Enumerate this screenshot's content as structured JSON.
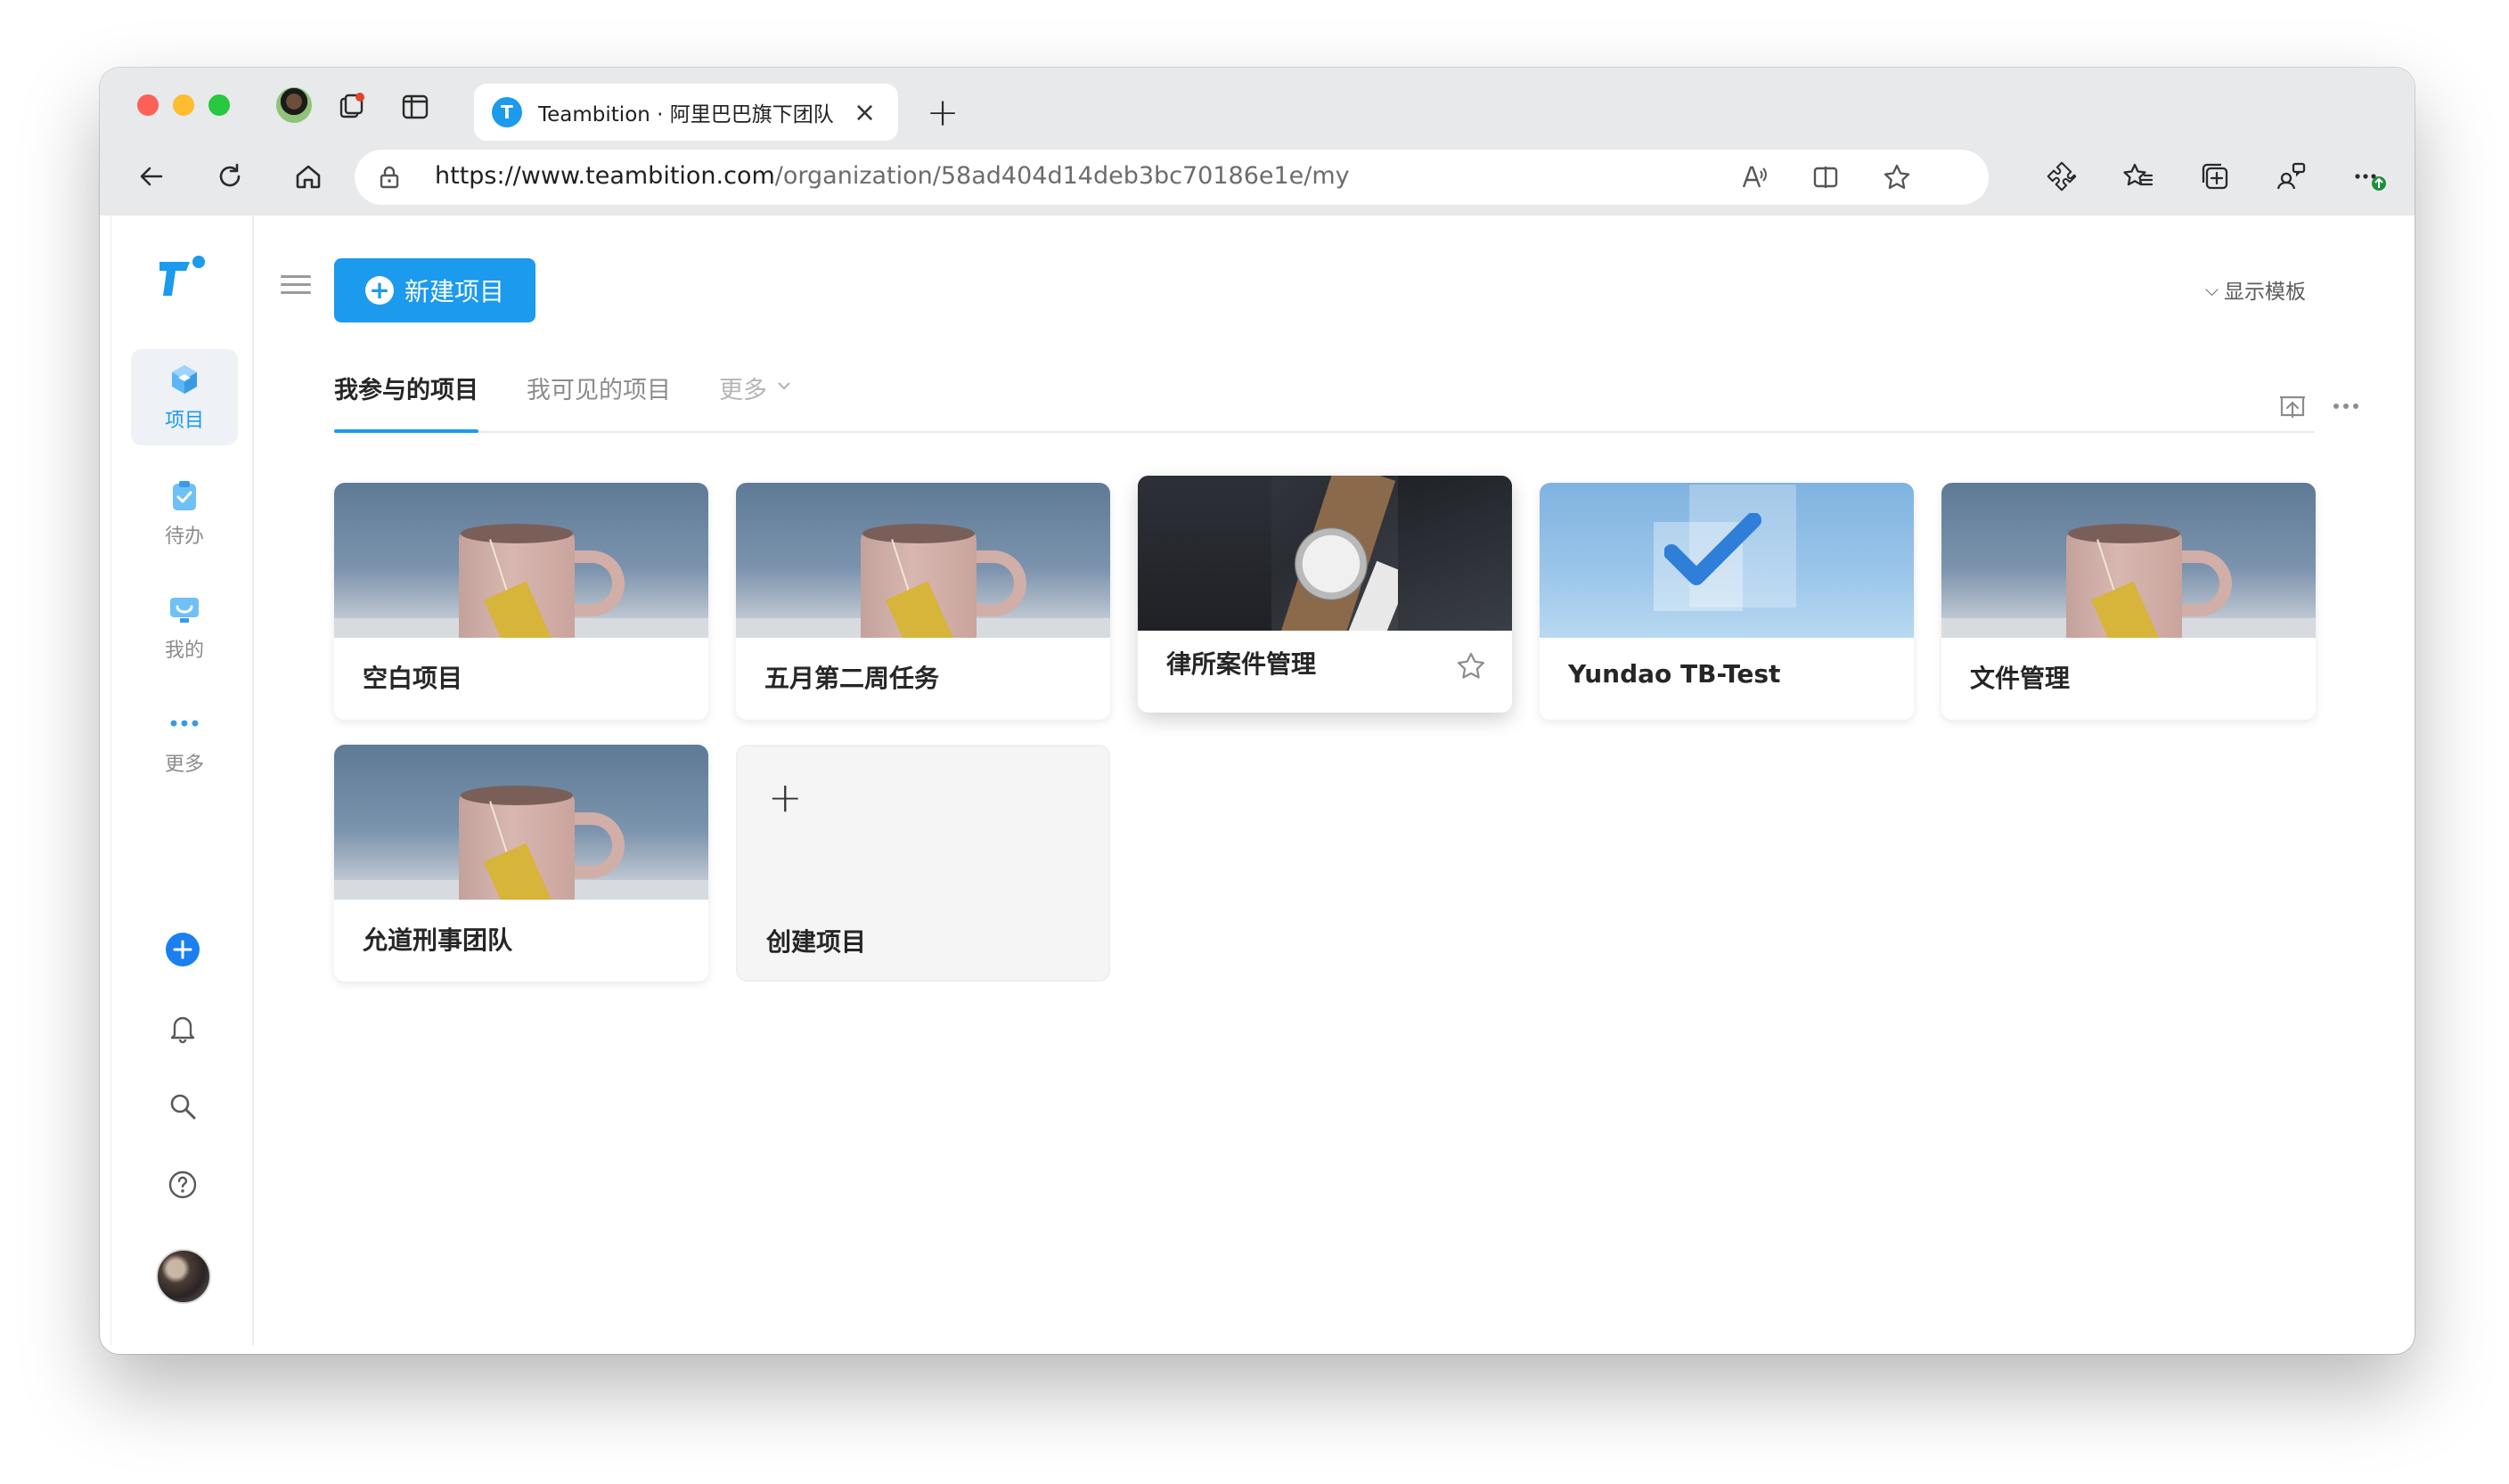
{
  "browser": {
    "tab_title": "Teambition · 阿里巴巴旗下团队",
    "tab_favicon_letter": "T",
    "url_host": "https://www.teambition.com",
    "url_path": "/organization/58ad404d14deb3bc70186e1e/my",
    "icons": [
      "back-icon",
      "refresh-icon",
      "home-icon",
      "lock-icon",
      "read-aloud-icon",
      "split-screen-icon",
      "favorite-star-icon",
      "extensions-icon",
      "favorites-icon",
      "collections-icon",
      "profile-sync-icon",
      "more-icon"
    ]
  },
  "sidebar": {
    "items": [
      {
        "label": "项目",
        "icon": "project-cube-icon",
        "active": true
      },
      {
        "label": "待办",
        "icon": "todo-clipboard-icon",
        "active": false
      },
      {
        "label": "我的",
        "icon": "my-monitor-icon",
        "active": false
      },
      {
        "label": "更多",
        "icon": "more-dots-icon",
        "active": false
      }
    ],
    "bottom_icons": [
      "add-circle-icon",
      "bell-icon",
      "search-icon",
      "help-icon"
    ],
    "accent_color": "#1b9aee"
  },
  "toolbar": {
    "new_project_label": "新建项目",
    "show_template_label": "显示模板"
  },
  "tabs": {
    "items": [
      {
        "label": "我参与的项目",
        "active": true
      },
      {
        "label": "我可见的项目",
        "active": false
      },
      {
        "label": "更多",
        "active": false
      }
    ]
  },
  "projects": [
    {
      "name": "空白项目",
      "cover": "mug"
    },
    {
      "name": "五月第二周任务",
      "cover": "mug"
    },
    {
      "name": "律所案件管理",
      "cover": "watch",
      "hovered": true
    },
    {
      "name": "Yundao TB-Test",
      "cover": "check"
    },
    {
      "name": "文件管理",
      "cover": "mug"
    },
    {
      "name": "允道刑事团队",
      "cover": "mug"
    }
  ],
  "create_project_label": "创建项目"
}
